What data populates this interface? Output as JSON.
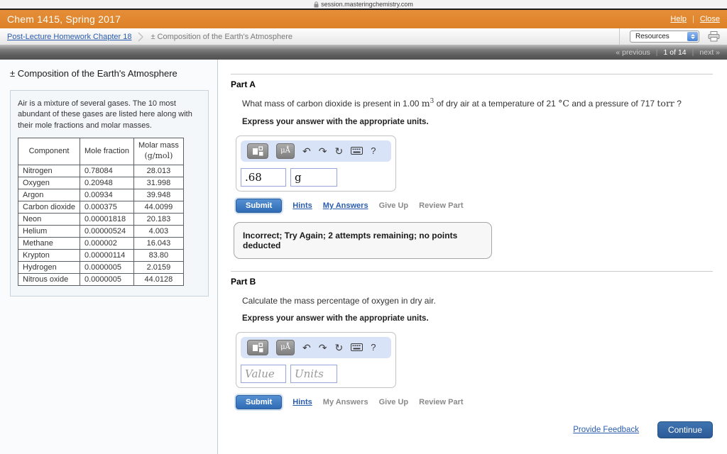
{
  "browser": {
    "url": "session.masteringchemistry.com"
  },
  "header": {
    "title": "Chem 1415, Spring 2017",
    "help": "Help",
    "close": "Close"
  },
  "breadcrumb": {
    "parent": "Post-Lecture Homework Chapter 18",
    "current": "± Composition of the Earth's Atmosphere"
  },
  "resources": {
    "label": "Resources"
  },
  "pager": {
    "previous": "« previous",
    "position": "1 of 14",
    "next": "next »"
  },
  "left_panel": {
    "title": "± Composition of the Earth's Atmosphere",
    "intro": "Air is a mixture of several gases. The 10 most abundant of these gases are listed here along with their mole fractions and molar masses.",
    "table": {
      "headers": {
        "component": "Component",
        "mole_fraction": "Mole fraction",
        "molar_mass_line1": "Molar mass",
        "molar_mass_line2": "(g/mol)"
      },
      "rows": [
        {
          "component": "Nitrogen",
          "mole_fraction": "0.78084",
          "molar_mass": "28.013"
        },
        {
          "component": "Oxygen",
          "mole_fraction": "0.20948",
          "molar_mass": "31.998"
        },
        {
          "component": "Argon",
          "mole_fraction": "0.00934",
          "molar_mass": "39.948"
        },
        {
          "component": "Carbon dioxide",
          "mole_fraction": "0.000375",
          "molar_mass": "44.0099"
        },
        {
          "component": "Neon",
          "mole_fraction": "0.00001818",
          "molar_mass": "20.183"
        },
        {
          "component": "Helium",
          "mole_fraction": "0.00000524",
          "molar_mass": "4.003"
        },
        {
          "component": "Methane",
          "mole_fraction": "0.000002",
          "molar_mass": "16.043"
        },
        {
          "component": "Krypton",
          "mole_fraction": "0.00000114",
          "molar_mass": "83.80"
        },
        {
          "component": "Hydrogen",
          "mole_fraction": "0.0000005",
          "molar_mass": "2.0159"
        },
        {
          "component": "Nitrous oxide",
          "mole_fraction": "0.0000005",
          "molar_mass": "44.0128"
        }
      ]
    }
  },
  "answer_toolbar": {
    "units_button": "μÅ",
    "undo": "↶",
    "redo": "↷",
    "reset": "↻",
    "help": "?"
  },
  "actions": {
    "submit": "Submit",
    "hints": "Hints",
    "my_answers": "My Answers",
    "give_up": "Give Up",
    "review_part": "Review Part"
  },
  "express": "Express your answer with the appropriate units.",
  "part_a": {
    "label": "Part A",
    "question": {
      "t1": "What mass of carbon dioxide is present in 1.00 ",
      "unit1": "m",
      "unit1_sup": "3",
      "t2": " of dry air at a temperature of 21 ",
      "unit2": "°C",
      "t3": " and a pressure of 717 ",
      "unit3": "torr",
      "t4": " ?"
    },
    "answer": {
      "value": ".68",
      "units": "g"
    },
    "feedback": "Incorrect; Try Again; 2 attempts remaining; no points deducted"
  },
  "part_b": {
    "label": "Part B",
    "question": "Calculate the mass percentage of oxygen in dry air.",
    "answer": {
      "value_placeholder": "Value",
      "units_placeholder": "Units"
    }
  },
  "footer": {
    "provide_feedback": "Provide Feedback",
    "continue_label": "Continue"
  },
  "colors": {
    "accent_orange": "#e0862e",
    "link_blue": "#2a5db0",
    "submit_blue": "#3273c5",
    "continue_blue": "#2d5e9e",
    "input_border": "#96a5da"
  }
}
